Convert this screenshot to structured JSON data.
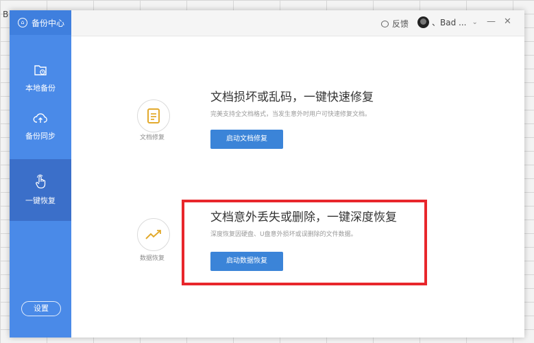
{
  "app": {
    "title": "备份中心",
    "bg_cell_label": "B"
  },
  "sidebar": {
    "items": [
      {
        "label": "本地备份",
        "icon": "folder-clock-icon",
        "active": false
      },
      {
        "label": "备份同步",
        "icon": "cloud-upload-icon",
        "active": false
      },
      {
        "label": "一键恢复",
        "icon": "hand-pointer-icon",
        "active": true
      }
    ],
    "settings_label": "设置"
  },
  "topbar": {
    "feedback_label": "反馈",
    "user_name": "、Bad ..."
  },
  "features": [
    {
      "icon_label": "文档修复",
      "title": "文档损坏或乱码，一键快速修复",
      "desc": "完美支持全文档格式，当发生意外时用户可快速修复文档。",
      "button": "启动文档修复",
      "icon": "document-icon",
      "icon_color": "#e2a92b"
    },
    {
      "icon_label": "数据恢复",
      "title": "文档意外丢失或删除，一键深度恢复",
      "desc": "深度恢复因硬盘、U盘意外损坏或误删除的文件数据。",
      "button": "启动数据恢复",
      "icon": "trend-line-icon",
      "icon_color": "#e2a92b"
    }
  ],
  "colors": {
    "sidebar": "#4a8ae8",
    "active": "#3b6fc9",
    "button": "#3b84d8",
    "highlight": "#e8262b"
  }
}
